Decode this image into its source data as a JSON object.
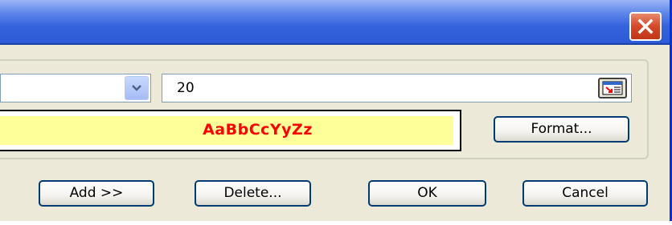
{
  "dialog": {
    "close_icon": "close-icon"
  },
  "font": {
    "combo_icon": "chevron-down-icon"
  },
  "size": {
    "value": "20",
    "picker_icon": "cell-picker-icon"
  },
  "preview": {
    "sample_text": "AaBbCcYyZz",
    "text_color": "#ff0000",
    "background_color": "#ffff99"
  },
  "buttons": {
    "format": "Format...",
    "add": "Add >>",
    "delete": "Delete...",
    "ok": "OK",
    "cancel": "Cancel"
  },
  "colors": {
    "title_bar": "#2d5ad6",
    "dialog_bg": "#ece9d8",
    "close_button": "#d5482a"
  }
}
